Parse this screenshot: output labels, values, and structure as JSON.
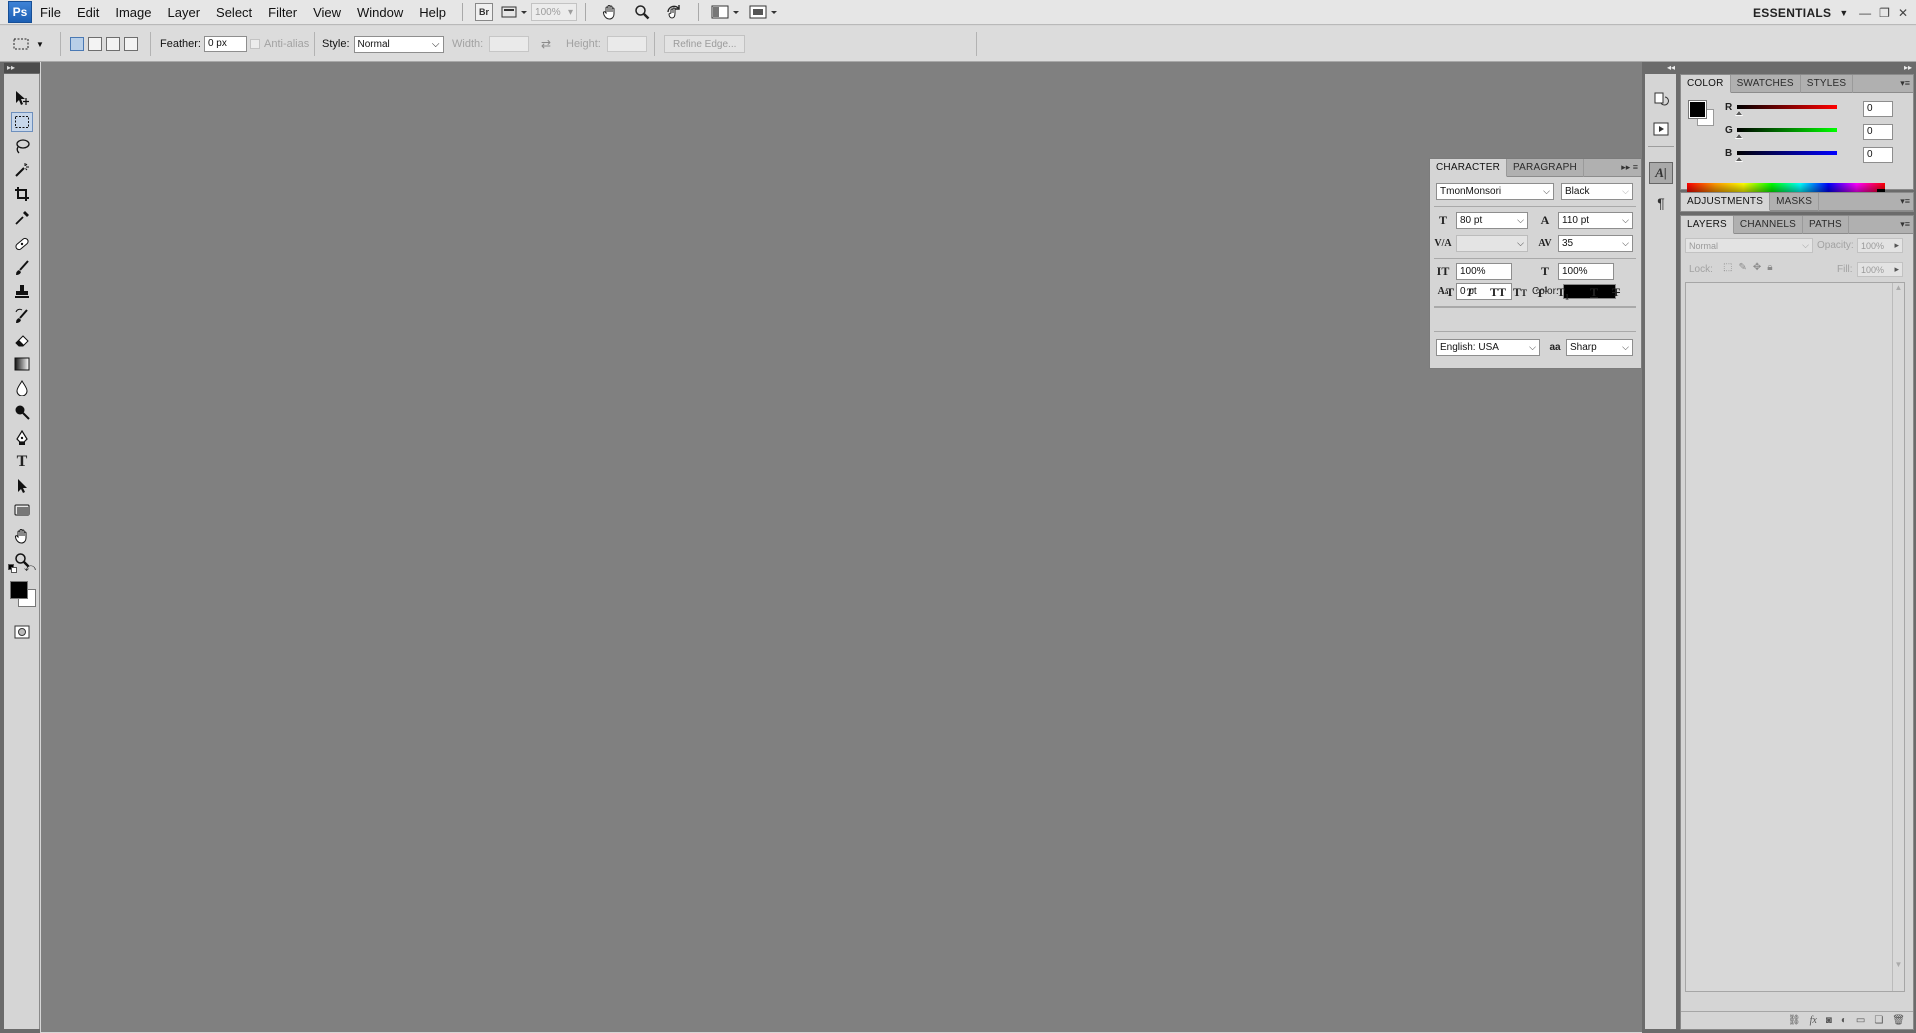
{
  "app": {
    "logo": "Ps",
    "menu": [
      "File",
      "Edit",
      "Image",
      "Layer",
      "Select",
      "Filter",
      "View",
      "Window",
      "Help"
    ],
    "bridge_label": "Br",
    "zoom": "100%",
    "workspace": "ESSENTIALS"
  },
  "options": {
    "feather_label": "Feather:",
    "feather_value": "0 px",
    "antialias_label": "Anti-alias",
    "style_label": "Style:",
    "style_value": "Normal",
    "width_label": "Width:",
    "height_label": "Height:",
    "refine_label": "Refine Edge..."
  },
  "color_panel": {
    "tabs": [
      "COLOR",
      "SWATCHES",
      "STYLES"
    ],
    "channels": [
      {
        "label": "R",
        "value": "0",
        "color": "#e40000"
      },
      {
        "label": "G",
        "value": "0",
        "color": "#00c000"
      },
      {
        "label": "B",
        "value": "0",
        "color": "#0000e0"
      }
    ]
  },
  "adjustments_panel": {
    "tabs": [
      "ADJUSTMENTS",
      "MASKS"
    ]
  },
  "layers_panel": {
    "tabs": [
      "LAYERS",
      "CHANNELS",
      "PATHS"
    ],
    "blend_mode": "Normal",
    "opacity_label": "Opacity:",
    "opacity_value": "100%",
    "lock_label": "Lock:",
    "fill_label": "Fill:",
    "fill_value": "100%"
  },
  "character_panel": {
    "tabs": [
      "CHARACTER",
      "PARAGRAPH"
    ],
    "font_family": "TmonMonsori",
    "font_style": "Black",
    "font_size": "80 pt",
    "leading": "110 pt",
    "kerning": "",
    "tracking": "35",
    "vertical_scale": "100%",
    "horizontal_scale": "100%",
    "baseline_shift": "0 pt",
    "color_label": "Color:",
    "text_color": "#000000",
    "language": "English: USA",
    "antialias": "Sharp",
    "aa_icon": "aa"
  },
  "colors": {
    "foreground": "#000000",
    "background": "#ffffff",
    "canvas": "#808080"
  }
}
